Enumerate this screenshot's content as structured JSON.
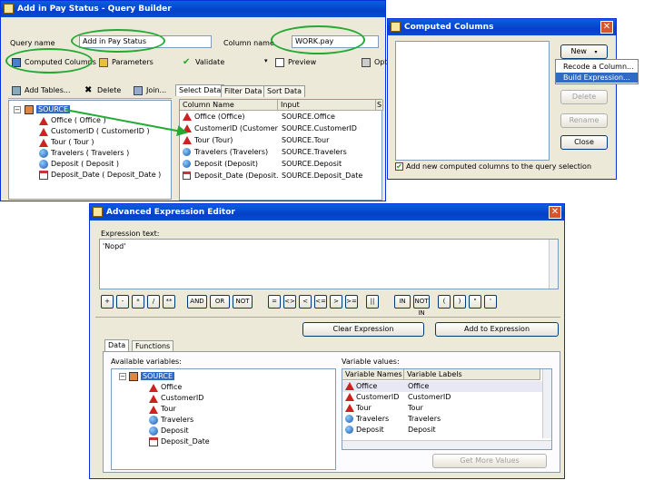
{
  "query_builder": {
    "title": "Add in Pay Status - Query Builder",
    "query_name_label": "Query name",
    "query_name_value": "Add in Pay Status",
    "column_name_label": "Column name",
    "column_name_value": "WORK.pay",
    "toolbar": {
      "computed_columns": "Computed Columns",
      "parameters": "Parameters",
      "validate": "Validate",
      "preview": "Preview",
      "options": "Opt"
    },
    "tree_toolbar": {
      "add_tables": "Add Tables...",
      "delete": "Delete",
      "join": "Join..."
    },
    "tree": {
      "root": "SOURCE",
      "items": [
        "Office ( Office )",
        "CustomerID ( CustomerID )",
        "Tour ( Tour )",
        "Travelers ( Travelers )",
        "Deposit ( Deposit )",
        "Deposit_Date ( Deposit_Date )"
      ]
    },
    "tabs": [
      "Select Data",
      "Filter Data",
      "Sort Data"
    ],
    "grid_headers": [
      "Column Name",
      "Input",
      "S"
    ],
    "grid_rows": [
      {
        "name": "Office (Office)",
        "input": "SOURCE.Office"
      },
      {
        "name": "CustomerID (CustomerID)",
        "input": "SOURCE.CustomerID"
      },
      {
        "name": "Tour (Tour)",
        "input": "SOURCE.Tour"
      },
      {
        "name": "Travelers (Travelers)",
        "input": "SOURCE.Travelers"
      },
      {
        "name": "Deposit (Deposit)",
        "input": "SOURCE.Deposit"
      },
      {
        "name": "Deposit_Date (Deposit...",
        "input": "SOURCE.Deposit_Date"
      }
    ]
  },
  "computed_columns": {
    "title": "Computed Columns",
    "new_button": "New",
    "menu_items": [
      "Recode a Column...",
      "Build Expression..."
    ],
    "delete_button": "Delete",
    "rename_button": "Rename",
    "close_button": "Close",
    "checkbox_label": "Add new computed columns to the query selection",
    "checkbox_checked": true
  },
  "expression_editor": {
    "title": "Advanced Expression Editor",
    "expression_label": "Expression text:",
    "expression_value": "'Nopd'",
    "operators": [
      "+",
      "-",
      "*",
      "/",
      "**",
      "AND",
      "OR",
      "NOT",
      "=",
      "<>",
      "<",
      "<=",
      ">",
      ">=",
      "||",
      "IN",
      "NOT IN",
      "(",
      ")",
      "\"",
      "'"
    ],
    "clear_button": "Clear Expression",
    "add_button": "Add to Expression",
    "tabs": [
      "Data",
      "Functions"
    ],
    "available_label": "Available variables:",
    "tree_root": "SOURCE",
    "tree_items": [
      "Office",
      "CustomerID",
      "Tour",
      "Travelers",
      "Deposit",
      "Deposit_Date"
    ],
    "variable_values_label": "Variable values:",
    "var_headers": [
      "Variable Names",
      "Variable Labels"
    ],
    "var_rows": [
      {
        "name": "Office",
        "label": "Office"
      },
      {
        "name": "CustomerID",
        "label": "CustomerID"
      },
      {
        "name": "Tour",
        "label": "Tour"
      },
      {
        "name": "Travelers",
        "label": "Travelers"
      },
      {
        "name": "Deposit",
        "label": "Deposit"
      }
    ],
    "get_more_button": "Get More Values"
  },
  "colors": {
    "annotation": "#22aa33",
    "selection": "#316ac5",
    "titlebar": "#0a5fe0"
  },
  "icons": [
    "computed-columns-icon",
    "parameters-icon",
    "validate-icon",
    "preview-icon",
    "add-tables-icon",
    "delete-x-icon",
    "join-icon",
    "source-table-icon",
    "character-column-icon",
    "numeric-column-icon",
    "date-column-icon",
    "close-icon"
  ]
}
